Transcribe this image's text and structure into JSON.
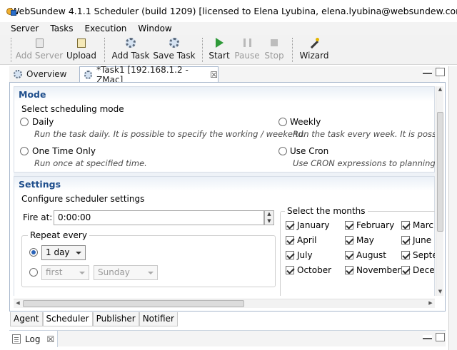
{
  "window": {
    "title": "WebSundew 4.1.1 Scheduler (build 1209) [licensed to Elena Lyubina, elena.lyubina@websundew.com]"
  },
  "menu": [
    "Server",
    "Tasks",
    "Execution",
    "Window"
  ],
  "toolbar": {
    "add_server": "Add Server",
    "upload": "Upload",
    "add_task": "Add Task",
    "save_task": "Save Task",
    "start": "Start",
    "pause": "Pause",
    "stop": "Stop",
    "wizard": "Wizard"
  },
  "tabs": {
    "overview": "Overview",
    "task": "*Task1 [192.168.1.2 - ZMac]"
  },
  "mode": {
    "heading": "Mode",
    "description": "Select scheduling mode",
    "daily_label": "Daily",
    "daily_desc": "Run the task daily. It is possible to specify the working / weekend.",
    "weekly_label": "Weekly",
    "weekly_desc": "Run the task every week. It is possible",
    "onetime_label": "One Time Only",
    "onetime_desc": "Run once at specified time.",
    "cron_label": "Use Cron",
    "cron_desc": "Use CRON expressions to planning tas"
  },
  "settings": {
    "heading": "Settings",
    "description": "Configure scheduler settings",
    "fire_at_label": "Fire at:",
    "fire_at_value": "0:00:00",
    "repeat_group": "Repeat every",
    "repeat_value": "1 day",
    "ordinal_value": "first",
    "weekday_value": "Sunday",
    "months_group": "Select the months",
    "months": [
      "January",
      "February",
      "Marc",
      "April",
      "May",
      "June",
      "July",
      "August",
      "Septe",
      "October",
      "November",
      "Dece"
    ]
  },
  "subtabs": [
    "Agent",
    "Scheduler",
    "Publisher",
    "Notifier"
  ],
  "log": {
    "tab": "Log"
  },
  "icons": {
    "add_server": "server-add-icon",
    "upload": "upload-icon",
    "add_task": "task-add-icon",
    "save_task": "task-save-icon",
    "start": "play-icon",
    "pause": "pause-icon",
    "stop": "stop-icon",
    "wizard": "wand-icon"
  },
  "colors": {
    "section_heading": "#1f4e8c",
    "start_green": "#2f9a39"
  }
}
